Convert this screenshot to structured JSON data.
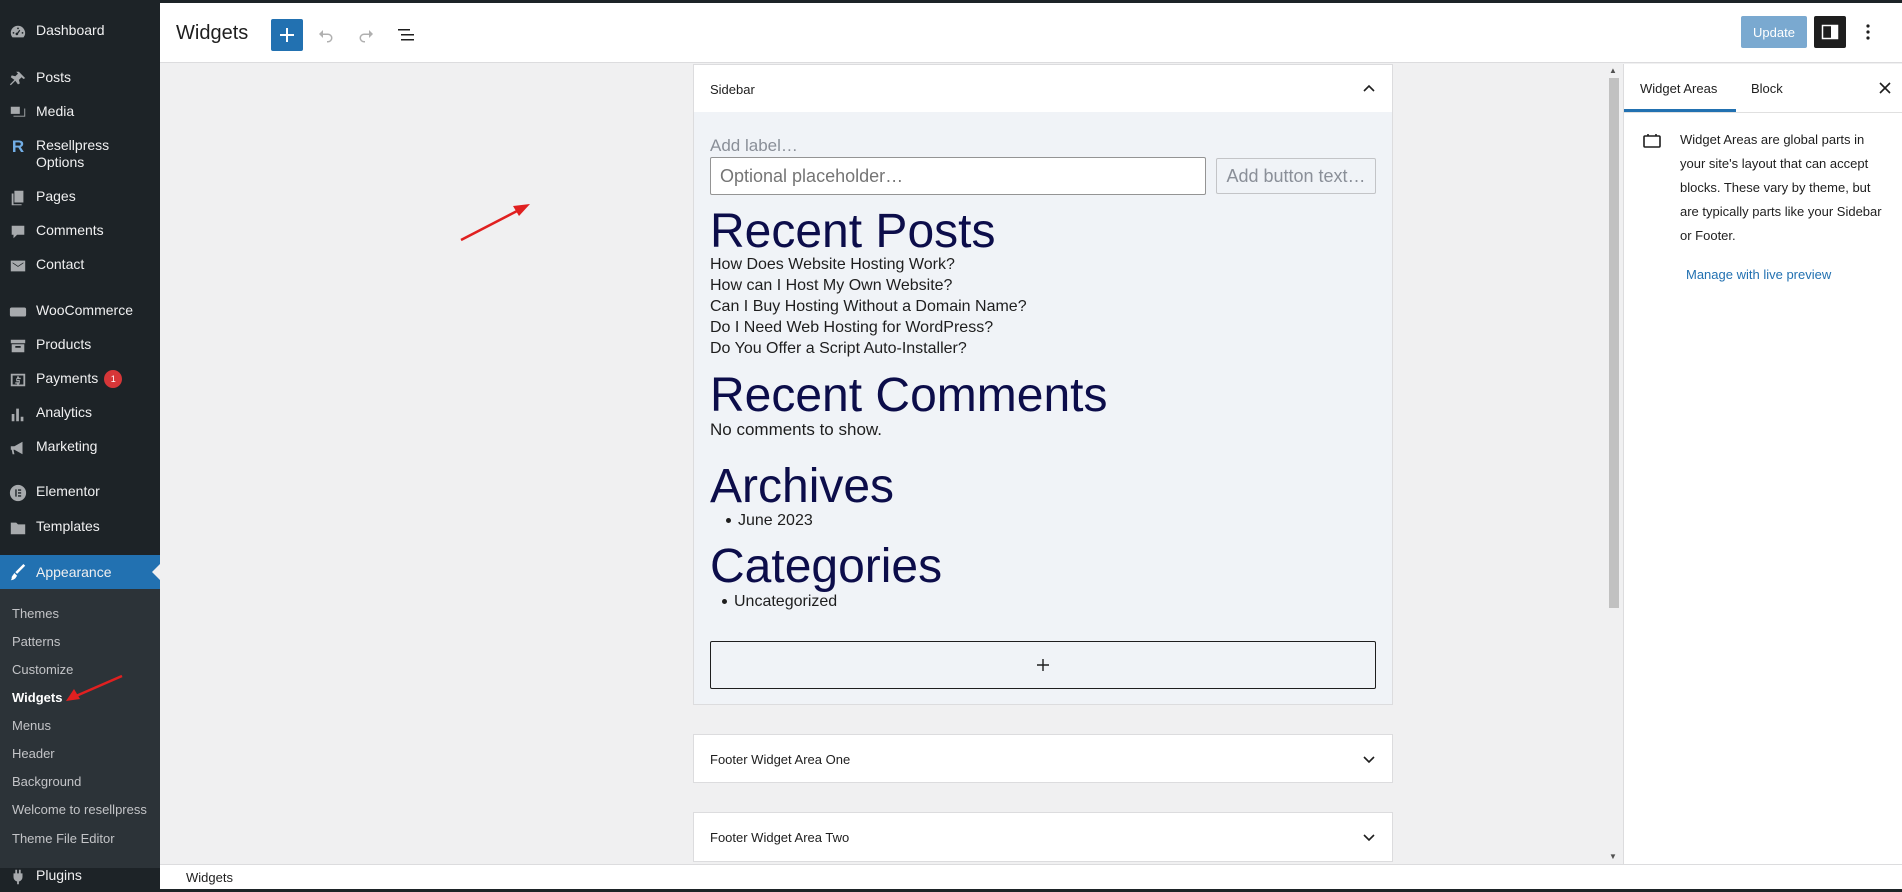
{
  "sidebar": {
    "items": [
      {
        "label": "Dashboard",
        "icon": "dashboard-icon"
      },
      {
        "label": "Posts",
        "icon": "pin-icon"
      },
      {
        "label": "Media",
        "icon": "media-icon"
      },
      {
        "label": "Resellpress Options",
        "icon": "resellpress-icon"
      },
      {
        "label": "Pages",
        "icon": "pages-icon"
      },
      {
        "label": "Comments",
        "icon": "comment-icon"
      },
      {
        "label": "Contact",
        "icon": "mail-icon"
      },
      {
        "label": "WooCommerce",
        "icon": "woo-icon"
      },
      {
        "label": "Products",
        "icon": "archive-icon"
      },
      {
        "label": "Payments",
        "icon": "dollar-icon",
        "badge": "1"
      },
      {
        "label": "Analytics",
        "icon": "chart-icon"
      },
      {
        "label": "Marketing",
        "icon": "megaphone-icon"
      },
      {
        "label": "Elementor",
        "icon": "elementor-icon"
      },
      {
        "label": "Templates",
        "icon": "folder-icon"
      },
      {
        "label": "Appearance",
        "icon": "brush-icon"
      },
      {
        "label": "Plugins",
        "icon": "plugin-icon"
      }
    ],
    "submenu": [
      "Themes",
      "Patterns",
      "Customize",
      "Widgets",
      "Menus",
      "Header",
      "Background",
      "Welcome to resellpress",
      "Theme File Editor"
    ]
  },
  "header": {
    "title": "Widgets",
    "update_label": "Update"
  },
  "areas": {
    "sidebar_title": "Sidebar",
    "footer1_title": "Footer Widget Area One",
    "footer2_title": "Footer Widget Area Two"
  },
  "search": {
    "label_placeholder": "Add label…",
    "input_placeholder": "Optional placeholder…",
    "button_placeholder": "Add button text…"
  },
  "recent_posts": {
    "title": "Recent Posts",
    "items": [
      "How Does Website Hosting Work?",
      "How can I Host My Own Website?",
      "Can I Buy Hosting Without a Domain Name?",
      "Do I Need Web Hosting for WordPress?",
      "Do You Offer a Script Auto-Installer?"
    ]
  },
  "recent_comments": {
    "title": "Recent Comments",
    "empty": "No comments to show."
  },
  "archives": {
    "title": "Archives",
    "items": [
      "June 2023"
    ]
  },
  "categories": {
    "title": "Categories",
    "items": [
      "Uncategorized"
    ]
  },
  "settings_panel": {
    "tab_areas": "Widget Areas",
    "tab_block": "Block",
    "description": "Widget Areas are global parts in your site's layout that can accept blocks. These vary by theme, but are typically parts like your Sidebar or Footer.",
    "link": "Manage with live preview"
  },
  "footer": {
    "breadcrumb": "Widgets"
  },
  "colors": {
    "admin_sidebar": "#1d2327",
    "accent": "#2271b1",
    "badge": "#d63638",
    "annotation_arrow": "#e02020"
  }
}
